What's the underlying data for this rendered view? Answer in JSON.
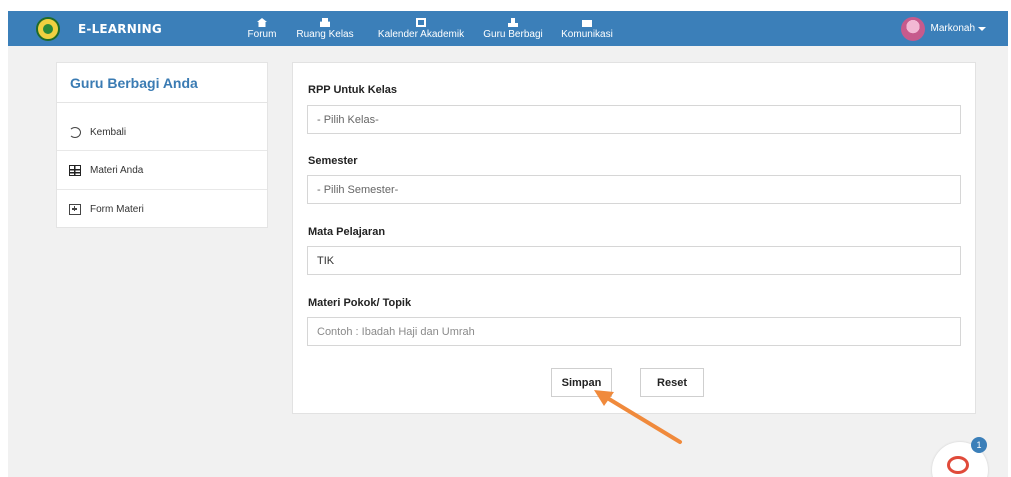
{
  "navbar": {
    "brand": "E-LEARNING",
    "items": [
      {
        "label": "Forum",
        "icon": "home-icon"
      },
      {
        "label": "Ruang Kelas",
        "icon": "room-icon"
      },
      {
        "label": "Kalender Akademik",
        "icon": "calendar-icon"
      },
      {
        "label": "Guru Berbagi",
        "icon": "teacher-icon"
      },
      {
        "label": "Komunikasi",
        "icon": "mail-icon"
      }
    ],
    "user": "Markonah"
  },
  "sidebar": {
    "title": "Guru Berbagi Anda",
    "items": [
      {
        "label": "Kembali",
        "icon": "history-icon"
      },
      {
        "label": "Materi Anda",
        "icon": "table-icon"
      },
      {
        "label": "Form Materi",
        "icon": "plus-square-icon"
      }
    ]
  },
  "form": {
    "kelas_label": "RPP Untuk Kelas",
    "kelas_value": "- Pilih Kelas-",
    "semester_label": "Semester",
    "semester_value": "- Pilih Semester-",
    "mapel_label": "Mata Pelajaran",
    "mapel_value": "TIK",
    "topik_label": "Materi Pokok/ Topik",
    "topik_placeholder": "Contoh : Ibadah Haji dan Umrah",
    "save_label": "Simpan",
    "reset_label": "Reset"
  },
  "chat": {
    "badge": "1"
  },
  "colors": {
    "navbar": "#3b7fb9",
    "sidebar_title": "#3a7bb3",
    "arrow": "#f08a3c",
    "chat_accent": "#e04a3a"
  }
}
